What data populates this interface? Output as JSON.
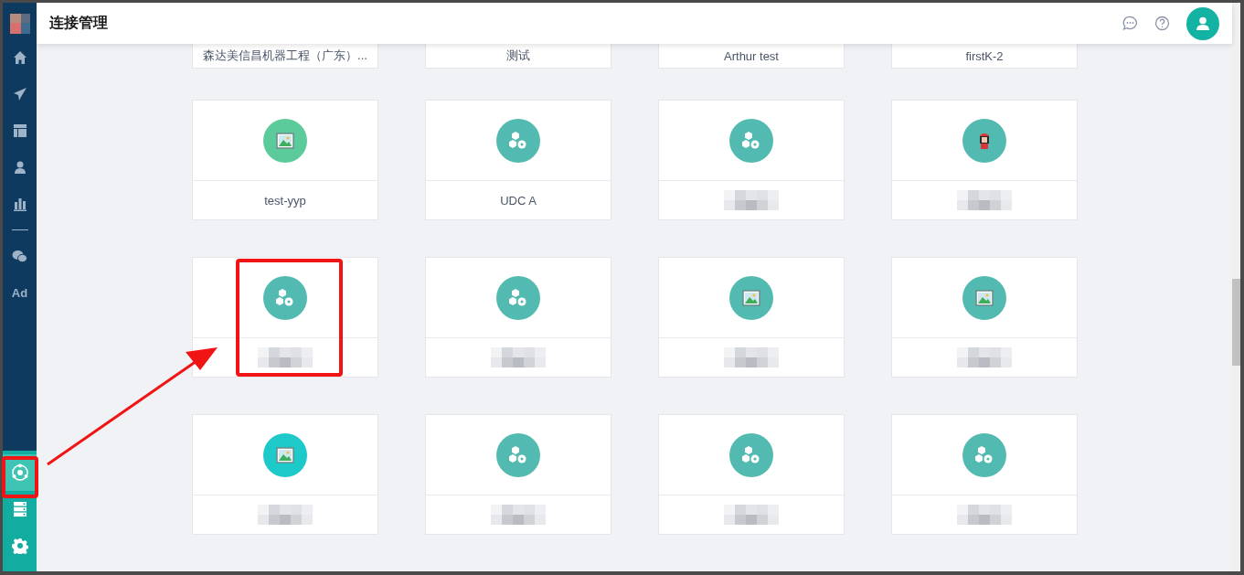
{
  "header": {
    "title": "连接管理"
  },
  "sidebar": {
    "top_items": [
      {
        "kind": "home",
        "selected": false
      },
      {
        "kind": "send",
        "selected": false
      },
      {
        "kind": "layout",
        "selected": false
      },
      {
        "kind": "user",
        "selected": false
      },
      {
        "kind": "chart",
        "selected": false
      },
      {
        "kind": "divider"
      },
      {
        "kind": "wechat",
        "selected": false
      },
      {
        "kind": "text",
        "label": "Ad",
        "selected": false
      }
    ],
    "bottom_items": [
      {
        "kind": "network",
        "selected": true
      },
      {
        "kind": "server",
        "selected": false
      },
      {
        "kind": "gear",
        "selected": false
      }
    ]
  },
  "partial_cards": [
    {
      "label": "森达美信昌机器工程（广东）..."
    },
    {
      "label": "测试"
    },
    {
      "label": "Arthur test"
    },
    {
      "label": "firstK-2"
    }
  ],
  "cards": [
    {
      "kind": "image",
      "color": "#5ccb9b",
      "label": "test-yyp"
    },
    {
      "kind": "cubes",
      "color": "#52bab0",
      "label": "UDC A"
    },
    {
      "kind": "cubes",
      "color": "#52bab0"
    },
    {
      "kind": "avatar",
      "color": "#52bab0"
    },
    {
      "kind": "cubes",
      "color": "#52bab0"
    },
    {
      "kind": "cubes",
      "color": "#52bab0"
    },
    {
      "kind": "image",
      "color": "#52bab0"
    },
    {
      "kind": "image",
      "color": "#52bab0"
    },
    {
      "kind": "image",
      "color": "#1ec9c9"
    },
    {
      "kind": "cubes",
      "color": "#52bab0"
    },
    {
      "kind": "cubes",
      "color": "#52bab0"
    },
    {
      "kind": "cubes",
      "color": "#52bab0"
    }
  ],
  "annotations": [
    {
      "kind": "card_box"
    },
    {
      "kind": "sidebar_box"
    },
    {
      "kind": "arrow"
    }
  ]
}
